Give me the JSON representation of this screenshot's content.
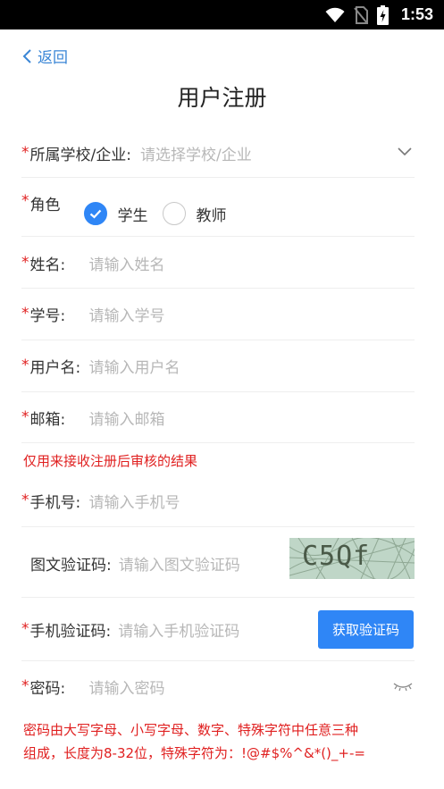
{
  "status_bar": {
    "time": "1:53"
  },
  "nav": {
    "back_label": "返回"
  },
  "page": {
    "title": "用户注册"
  },
  "form": {
    "school": {
      "required": "*",
      "label": "所属学校/企业:",
      "placeholder": "请选择学校/企业"
    },
    "role": {
      "required": "*",
      "label": "角色",
      "options": [
        {
          "label": "学生",
          "selected": true
        },
        {
          "label": "教师",
          "selected": false
        }
      ]
    },
    "name": {
      "required": "*",
      "label": "姓名:",
      "placeholder": "请输入姓名"
    },
    "student_id": {
      "required": "*",
      "label": "学号:",
      "placeholder": "请输入学号"
    },
    "username": {
      "required": "*",
      "label": "用户名:",
      "placeholder": "请输入用户名"
    },
    "email": {
      "required": "*",
      "label": "邮箱:",
      "placeholder": "请输入邮箱",
      "hint": "仅用来接收注册后审核的结果"
    },
    "phone": {
      "required": "*",
      "label": "手机号:",
      "placeholder": "请输入手机号"
    },
    "image_captcha": {
      "label": "图文验证码:",
      "placeholder": "请输入图文验证码",
      "captcha_text": "C5Qf"
    },
    "sms_code": {
      "required": "*",
      "label": "手机验证码:",
      "placeholder": "请输入手机验证码",
      "button_label": "获取验证码"
    },
    "password": {
      "required": "*",
      "label": "密码:",
      "placeholder": "请输入密码",
      "hint_line1": "密码由大写字母、小写字母、数字、特殊字符中任意三种",
      "hint_line2": "组成，长度为8-32位，特殊字符为：!@#$%^&*()_+-="
    }
  },
  "colors": {
    "accent": "#2f86f6",
    "required": "#e02020",
    "link": "#3a86d6"
  }
}
